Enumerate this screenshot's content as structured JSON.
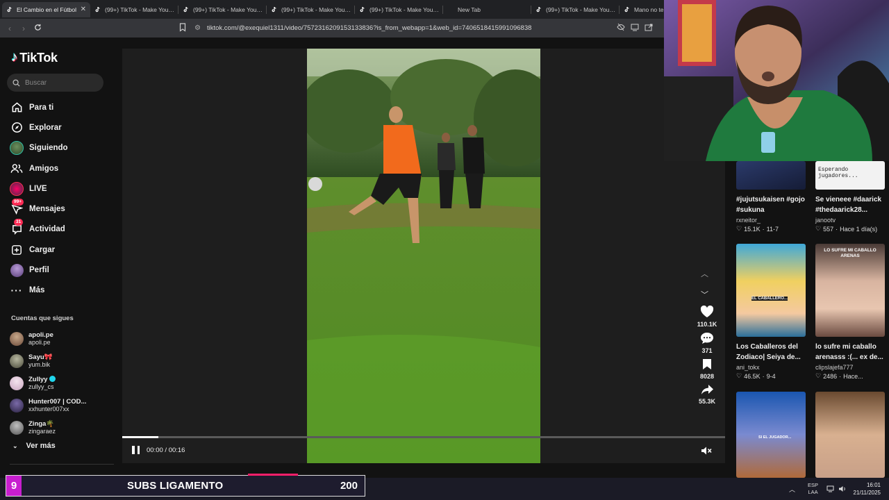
{
  "browser": {
    "tabs": [
      {
        "label": "El Cambio en el Fútbol",
        "active": true
      },
      {
        "label": "(99+) TikTok - Make Your D",
        "active": false
      },
      {
        "label": "(99+) TikTok - Make Your D",
        "active": false
      },
      {
        "label": "(99+) TikTok - Make Your D",
        "active": false
      },
      {
        "label": "(99+) TikTok - Make Your D",
        "active": false
      },
      {
        "label": "New Tab",
        "active": false
      },
      {
        "label": "(99+) TikTok - Make Your D",
        "active": false
      },
      {
        "label": "Mano no te",
        "active": false
      }
    ],
    "url": "tiktok.com/@exequiel1311/video/7572316209153133836?is_from_webapp=1&web_id=7406518415991096838"
  },
  "sidebar": {
    "brand": "TikTok",
    "search_placeholder": "Buscar",
    "nav": [
      {
        "label": "Para ti",
        "icon": "home-icon"
      },
      {
        "label": "Explorar",
        "icon": "compass-icon"
      },
      {
        "label": "Siguiendo",
        "icon": "following-avatar"
      },
      {
        "label": "Amigos",
        "icon": "friends-icon"
      },
      {
        "label": "LIVE",
        "icon": "live-icon"
      },
      {
        "label": "Mensajes",
        "icon": "messages-icon",
        "badge": "99+"
      },
      {
        "label": "Actividad",
        "icon": "activity-icon",
        "badge": "31"
      },
      {
        "label": "Cargar",
        "icon": "upload-icon"
      },
      {
        "label": "Perfil",
        "icon": "profile-avatar"
      },
      {
        "label": "Más",
        "icon": "more-icon"
      }
    ],
    "following_title": "Cuentas que sigues",
    "accounts": [
      {
        "name": "apoli.pe",
        "handle": "apoli.pe"
      },
      {
        "name": "Sayu🎀",
        "handle": "yum.bik"
      },
      {
        "name": "Zullyy",
        "handle": "zullyy_cs",
        "verified": true
      },
      {
        "name": "Hunter007 | COD...",
        "handle": "xxhunter007xx"
      },
      {
        "name": "Zinga🌴",
        "handle": "zingaraez"
      }
    ],
    "see_more": "Ver más"
  },
  "player": {
    "time": "00:00 / 00:16",
    "progress": 0.06,
    "likes": "110.1K",
    "comments": "371",
    "saves": "8028",
    "shares": "55.3K"
  },
  "recommendations": [
    {
      "title": "#jujutsukaisen #gojo #sukuna",
      "author": "rxneitor_",
      "likes": "15.1K",
      "date": "11-7"
    },
    {
      "title": "Se vieneee #daarick #thedaarick28...",
      "author": "janootv",
      "likes": "557",
      "date": "Hace 1 día(s)",
      "thumb_text": "Esperando jugadores..."
    },
    {
      "title": "Los Caballeros del Zodiaco| Seiya de...",
      "author": "ani_tokx",
      "likes": "46.5K",
      "date": "9-4",
      "thumb_text": "EL CABALLERO..."
    },
    {
      "title": "lo sufre mi caballo arenasss :(... ex de...",
      "author": "clipslajefa777",
      "likes": "2486",
      "date": "Hace...",
      "thumb_text": "LO SUFRE MI CABALLO ARENAS"
    },
    {
      "title": "",
      "author": "",
      "likes": "",
      "date": "",
      "thumb_text": "SI EL JUGADOR..."
    },
    {
      "title": "",
      "author": "",
      "likes": "",
      "date": ""
    }
  ],
  "stream_overlay": {
    "level": "9",
    "label": "SUBS LIGAMENTO",
    "count": "200"
  },
  "taskbar": {
    "lang_line1": "ESP",
    "lang_line2": "LAA",
    "time": "16:01",
    "date": "21/11/2025"
  },
  "colors": {
    "accent": "#fe2c55",
    "cyan": "#25f4ee",
    "overlay_magenta": "#c81ecf"
  }
}
